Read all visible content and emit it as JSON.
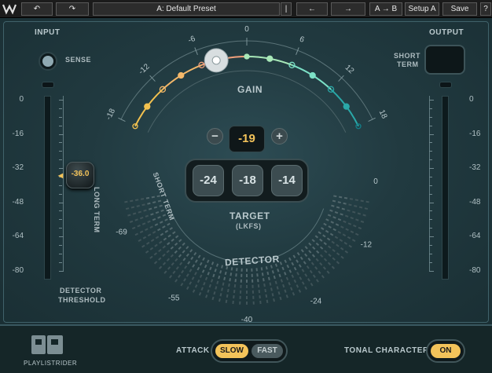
{
  "toolbar": {
    "undo": "↶",
    "redo": "↷",
    "preset": "A: Default Preset",
    "preset_menu": "|▼",
    "prev": "←",
    "next": "→",
    "ab": "A → B",
    "setup": "Setup A",
    "save": "Save"
  },
  "input": {
    "title": "INPUT",
    "sense_label": "SENSE",
    "scale": [
      "0",
      "-16",
      "-32",
      "-48",
      "-64",
      "-80"
    ],
    "threshold_value": "-36.0",
    "threshold_label": [
      "DETECTOR",
      "THRESHOLD"
    ],
    "threshold_marker": "◀"
  },
  "output": {
    "title": "OUTPUT",
    "short_term_label": [
      "SHORT",
      "TERM"
    ],
    "scale": [
      "0",
      "-16",
      "-32",
      "-48",
      "-64",
      "-80"
    ]
  },
  "gain": {
    "label": "GAIN",
    "value": "-19",
    "minus": "−",
    "plus": "+",
    "ticks": [
      "-18",
      "-12",
      "-6",
      "0",
      "6",
      "12",
      "18"
    ],
    "range": [
      -18,
      18
    ],
    "knob_at": -4
  },
  "target": {
    "label": "TARGET",
    "unit": "(LKFS)",
    "options": [
      "-24",
      "-18",
      "-14"
    ]
  },
  "detector": {
    "label": "DETECTOR",
    "long_term": "LONG TERM",
    "short_term": "SHORT TERM",
    "ticks": [
      "-69",
      "-55",
      "-40",
      "-24",
      "-12",
      "0"
    ]
  },
  "bottom": {
    "product": "PLAYLISTRIDER",
    "attack_label": "ATTACK",
    "attack_slow": "SLOW",
    "attack_fast": "FAST",
    "attack_selected": "SLOW",
    "tonal_label": "TONAL CHARACTER",
    "tonal_state": "ON"
  },
  "colors": {
    "accent": "#f3c35a",
    "gain_low": "#f0c060",
    "gain_mid": "#80e0c0",
    "gain_high": "#1a8c96"
  }
}
